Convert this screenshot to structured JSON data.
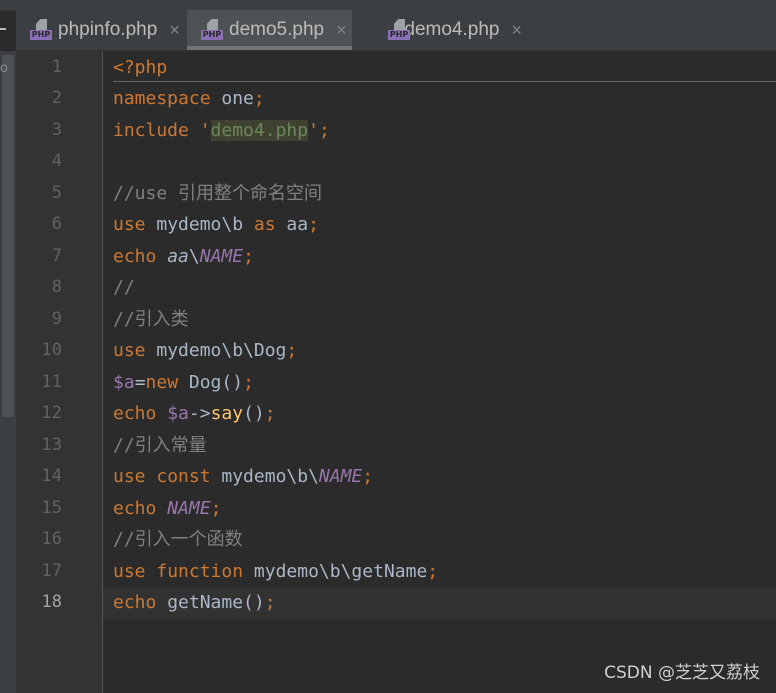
{
  "tabs": [
    {
      "label": "phpinfo.php",
      "icon": "php-file-icon",
      "active": false
    },
    {
      "label": "demo5.php",
      "icon": "php-file-icon",
      "active": true
    },
    {
      "label": "demo4.php",
      "icon": "php-file-icon",
      "active": false
    }
  ],
  "php_icon_label": "PHP",
  "close_glyph": "×",
  "left_fragment": "o",
  "current_line": 18,
  "colors": {
    "keyword": "#cc7832",
    "text": "#a9b7c6",
    "variable": "#9876aa",
    "string": "#6a8759",
    "comment": "#808080",
    "function": "#ffc66d",
    "background": "#2b2b2b"
  },
  "lines": [
    [
      [
        "<?php",
        "kw"
      ]
    ],
    [
      [
        "namespace",
        "kw"
      ],
      [
        " one",
        "tx"
      ],
      [
        ";",
        "kw"
      ]
    ],
    [
      [
        "include",
        "kw"
      ],
      [
        " '",
        "kw"
      ],
      [
        "demo4.php",
        "str"
      ],
      [
        "'",
        "kw"
      ],
      [
        ";",
        "kw"
      ]
    ],
    [],
    [
      [
        "//use 引用整个命名空间",
        "cm"
      ]
    ],
    [
      [
        "use",
        "kw"
      ],
      [
        " mydemo\\b ",
        "tx"
      ],
      [
        "as",
        "kw"
      ],
      [
        " aa",
        "tx"
      ],
      [
        ";",
        "kw"
      ]
    ],
    [
      [
        "echo",
        "kw"
      ],
      [
        " ",
        "tx"
      ],
      [
        "aa",
        "it"
      ],
      [
        "\\",
        "tx"
      ],
      [
        "NAME",
        "const"
      ],
      [
        ";",
        "kw"
      ]
    ],
    [
      [
        "//",
        "cm"
      ]
    ],
    [
      [
        "//引入类",
        "cm"
      ]
    ],
    [
      [
        "use",
        "kw"
      ],
      [
        " mydemo\\b\\Dog",
        "tx"
      ],
      [
        ";",
        "kw"
      ]
    ],
    [
      [
        "$a",
        "var"
      ],
      [
        "=",
        "tx"
      ],
      [
        "new",
        "kw"
      ],
      [
        " Dog()",
        "tx"
      ],
      [
        ";",
        "kw"
      ]
    ],
    [
      [
        "echo",
        "kw"
      ],
      [
        " ",
        "tx"
      ],
      [
        "$a",
        "var"
      ],
      [
        "->",
        "tx"
      ],
      [
        "say",
        "fn"
      ],
      [
        "()",
        "tx"
      ],
      [
        ";",
        "kw"
      ]
    ],
    [
      [
        "//引入常量",
        "cm"
      ]
    ],
    [
      [
        "use",
        "kw"
      ],
      [
        " ",
        "tx"
      ],
      [
        "const",
        "kw"
      ],
      [
        " mydemo\\b\\",
        "tx"
      ],
      [
        "NAME",
        "const"
      ],
      [
        ";",
        "kw"
      ]
    ],
    [
      [
        "echo",
        "kw"
      ],
      [
        " ",
        "tx"
      ],
      [
        "NAME",
        "const"
      ],
      [
        ";",
        "kw"
      ]
    ],
    [
      [
        "//引入一个函数",
        "cm"
      ]
    ],
    [
      [
        "use",
        "kw"
      ],
      [
        " ",
        "tx"
      ],
      [
        "function",
        "kw"
      ],
      [
        " mydemo\\b\\getName",
        "tx"
      ],
      [
        ";",
        "kw"
      ]
    ],
    [
      [
        "echo",
        "kw"
      ],
      [
        " getName()",
        "tx"
      ],
      [
        ";",
        "kw"
      ]
    ]
  ],
  "watermark": "CSDN @芝芝又荔枝"
}
